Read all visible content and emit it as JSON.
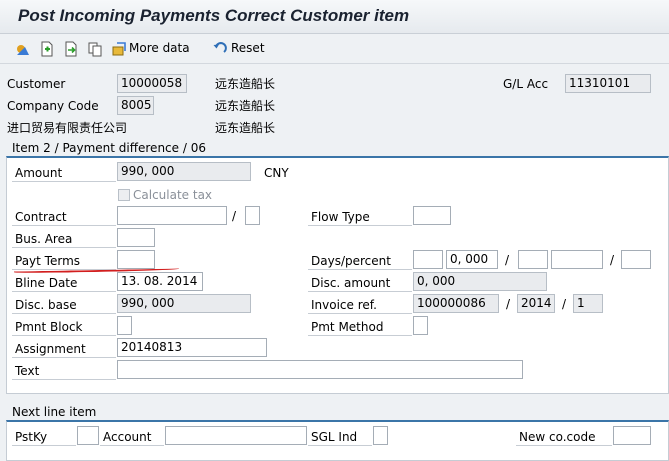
{
  "title": "Post Incoming Payments Correct Customer item",
  "toolbar": {
    "more_data": "More data",
    "reset": "Reset",
    "icons": [
      "choose-icon",
      "document-create-icon",
      "document-forward-icon",
      "copy-icon",
      "more-data-icon",
      "reset-icon"
    ]
  },
  "header": {
    "customer_label": "Customer",
    "customer_value": "10000058",
    "customer_name": "远东造船长",
    "company_code_label": "Company Code",
    "company_code_value": "8005",
    "company_name": "远东造船长",
    "company_text": "进口贸易有限责任公司",
    "city": "远东造船长",
    "gl_acc_label": "G/L Acc",
    "gl_acc_value": "11310101"
  },
  "item": {
    "section_title": "Item 2 / Payment difference / 06",
    "amount_label": "Amount",
    "amount_value": "990, 000",
    "currency": "CNY",
    "calculate_tax": "Calculate tax",
    "contract_label": "Contract",
    "contract_sep": "/",
    "flow_type_label": "Flow Type",
    "bus_area_label": "Bus. Area",
    "payt_terms_label": "Payt Terms",
    "days_percent_label": "Days/percent",
    "days_pct_value": "0, 000",
    "slash": "/",
    "bline_date_label": "Bline Date",
    "bline_date_value": "13. 08. 2014",
    "disc_amount_label": "Disc. amount",
    "disc_amount_value": "0, 000",
    "disc_base_label": "Disc. base",
    "disc_base_value": "990, 000",
    "invoice_ref_label": "Invoice ref.",
    "invoice_ref_doc": "100000086",
    "invoice_ref_year": "2014",
    "invoice_ref_item": "1",
    "pmnt_block_label": "Pmnt Block",
    "pmt_method_label": "Pmt Method",
    "assignment_label": "Assignment",
    "assignment_value": "20140813",
    "text_label": "Text",
    "text_value": ""
  },
  "next_line": {
    "section_title": "Next line item",
    "pstky_label": "PstKy",
    "account_label": "Account",
    "sgl_ind_label": "SGL Ind",
    "new_cocode_label": "New co.code"
  }
}
